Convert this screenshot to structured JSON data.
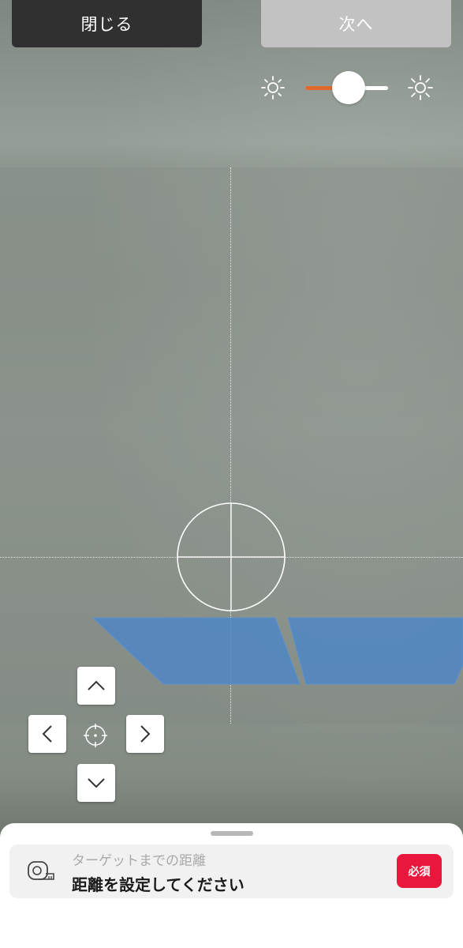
{
  "header": {
    "close_label": "閉じる",
    "next_label": "次へ",
    "next_enabled": false
  },
  "brightness": {
    "low_icon": "sun-dim-icon",
    "high_icon": "sun-bright-icon",
    "level": 0.5,
    "accent_color": "#e36a2e"
  },
  "dpad": {
    "up_icon": "chevron-up-icon",
    "down_icon": "chevron-down-icon",
    "left_icon": "chevron-left-icon",
    "right_icon": "chevron-right-icon",
    "center_icon": "crosshair-icon"
  },
  "distance": {
    "icon": "tape-measure-icon",
    "label": "ターゲットまでの距離",
    "value": "距離を設定してください",
    "badge": "必須",
    "badge_color": "#e8173b"
  }
}
